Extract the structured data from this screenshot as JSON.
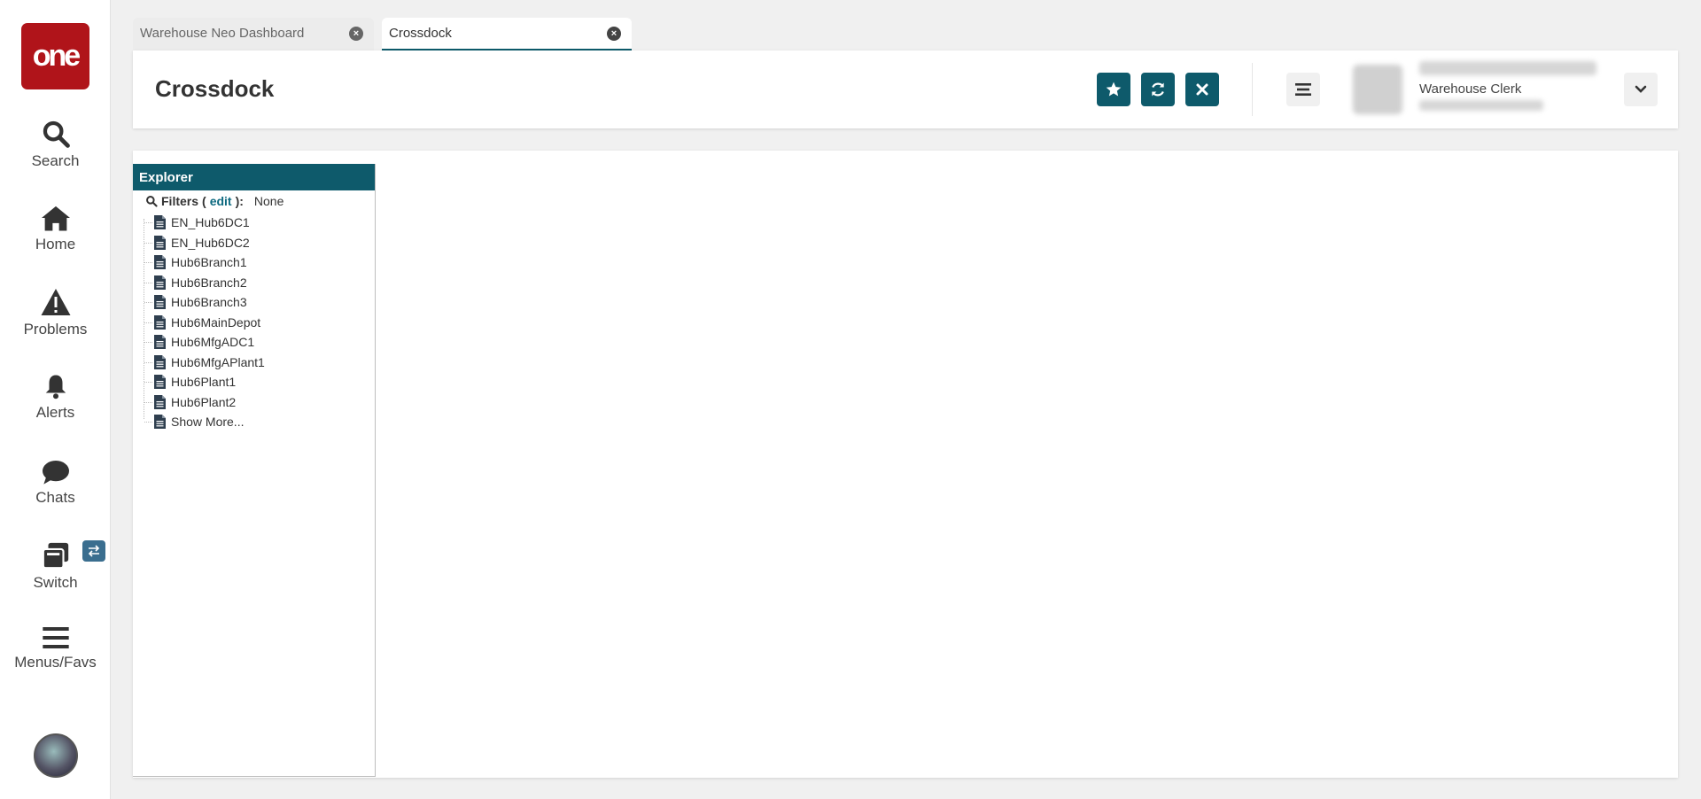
{
  "app": {
    "logo_text": "one",
    "brand_color": "#b0141a",
    "accent_color": "#0e5a6b"
  },
  "sidebar": {
    "items": [
      {
        "label": "Search",
        "icon": "search-icon"
      },
      {
        "label": "Home",
        "icon": "home-icon"
      },
      {
        "label": "Problems",
        "icon": "warning-icon"
      },
      {
        "label": "Alerts",
        "icon": "bell-icon"
      },
      {
        "label": "Chats",
        "icon": "chat-icon"
      },
      {
        "label": "Switch",
        "icon": "switch-icon"
      },
      {
        "label": "Menus/Favs",
        "icon": "menu-icon"
      }
    ]
  },
  "tabs": [
    {
      "label": "Warehouse Neo Dashboard",
      "active": false
    },
    {
      "label": "Crossdock",
      "active": true
    }
  ],
  "header": {
    "title": "Crossdock",
    "buttons": [
      "star-icon",
      "refresh-icon",
      "close-icon"
    ],
    "user_role": "Warehouse Clerk"
  },
  "explorer": {
    "title": "Explorer",
    "filters_label": "Filters",
    "filters_edit": "edit",
    "filters_value": "None",
    "items": [
      "EN_Hub6DC1",
      "EN_Hub6DC2",
      "Hub6Branch1",
      "Hub6Branch2",
      "Hub6Branch3",
      "Hub6MainDepot",
      "Hub6MfgADC1",
      "Hub6MfgAPlant1",
      "Hub6Plant1",
      "Hub6Plant2",
      "Show More..."
    ]
  }
}
